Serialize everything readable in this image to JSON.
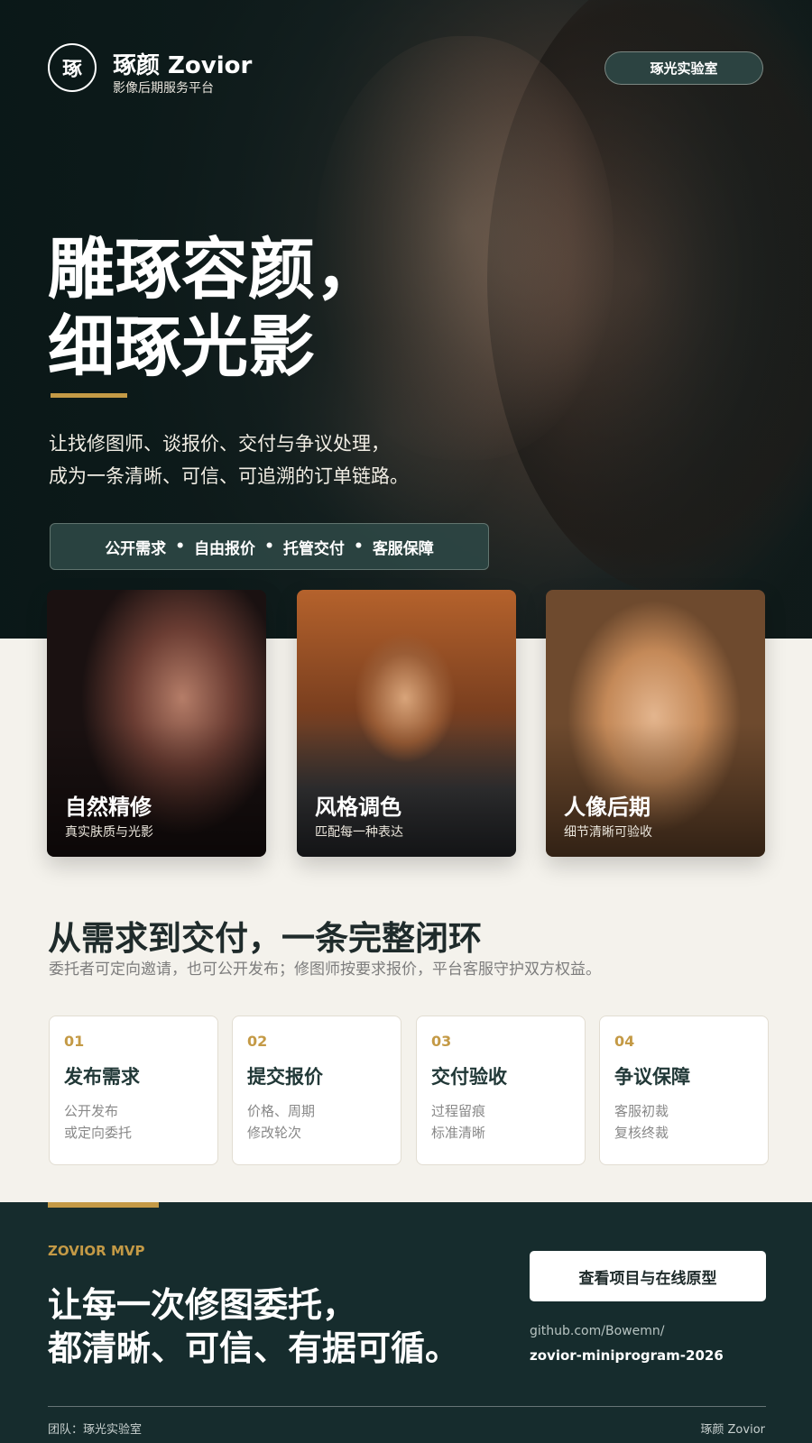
{
  "header": {
    "logo_char": "琢",
    "brand_name": "琢颜 Zovior",
    "brand_sub": "影像后期服务平台",
    "lab_button": "琢光实验室"
  },
  "hero": {
    "headline_lines": [
      "雕琢容颜，",
      "细琢光影"
    ],
    "intro_lines": [
      "让找修图师、谈报价、交付与争议处理，",
      "成为一条清晰、可信、可追溯的订单链路。"
    ],
    "tags": [
      "公开需求",
      "自由报价",
      "托管交付",
      "客服保障"
    ],
    "tag_separator": "•"
  },
  "cards": [
    {
      "title": "自然精修",
      "subtitle": "真实肤质与光影"
    },
    {
      "title": "风格调色",
      "subtitle": "匹配每一种表达"
    },
    {
      "title": "人像后期",
      "subtitle": "细节清晰可验收"
    }
  ],
  "process": {
    "title": "从需求到交付，一条完整闭环",
    "subtitle": "委托者可定向邀请，也可公开发布；修图师按要求报价，平台客服守护双方权益。",
    "steps": [
      {
        "num": "01",
        "title": "发布需求",
        "lines": [
          "公开发布",
          "或定向委托"
        ]
      },
      {
        "num": "02",
        "title": "提交报价",
        "lines": [
          "价格、周期",
          "修改轮次"
        ]
      },
      {
        "num": "03",
        "title": "交付验收",
        "lines": [
          "过程留痕",
          "标准清晰"
        ]
      },
      {
        "num": "04",
        "title": "争议保障",
        "lines": [
          "客服初裁",
          "复核终裁"
        ]
      }
    ]
  },
  "footer": {
    "eyebrow": "ZOVIOR MVP",
    "slogan_lines": [
      "让每一次修图委托，",
      "都清晰、可信、有据可循。"
    ],
    "cta_label": "查看项目与在线原型",
    "repo_host": "github.com/Bowemn/",
    "repo_name": "zovior-miniprogram-2026",
    "team": "团队：琢光实验室",
    "mark": "琢颜 Zovior"
  },
  "colors": {
    "accent_gold": "#c49a46",
    "dark_green": "#162c2d",
    "page_bg": "#f4f2ec"
  }
}
